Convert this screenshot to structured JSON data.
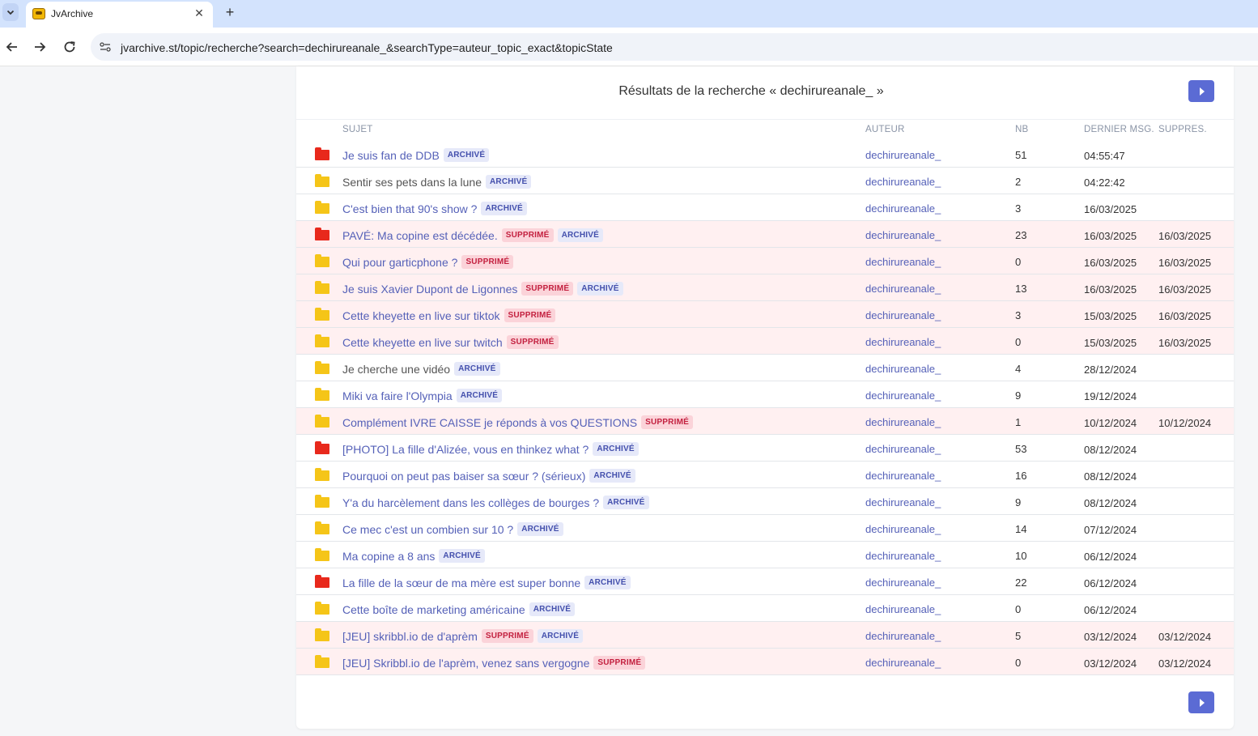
{
  "browser": {
    "tab_title": "JvArchive",
    "tab_close": "✕",
    "new_tab": "+",
    "url": "jvarchive.st/topic/recherche?search=dechirureanale_&searchType=auteur_topic_exact&topicState"
  },
  "page": {
    "title": "Résultats de la recherche « dechirureanale_ »",
    "columns": {
      "subject": "SUJET",
      "author": "AUTEUR",
      "nb": "NB",
      "last": "DERNIER MSG.",
      "deleted": "SUPPRES."
    },
    "badges": {
      "archived": "ARCHIVÉ",
      "deleted": "SUPPRIMÉ"
    },
    "accent_color": "#5b6bd4",
    "folder_colors": {
      "normal": "#f5c518",
      "hot": "#e8291c"
    }
  },
  "topics": [
    {
      "title": "Je suis fan de DDB",
      "author": "dechirureanale_",
      "nb": "51",
      "last": "04:55:47",
      "deleted_date": "",
      "folder": "red",
      "tags": [
        "archived"
      ],
      "deleted": false,
      "title_gray": false
    },
    {
      "title": "Sentir ses pets dans la lune",
      "author": "dechirureanale_",
      "nb": "2",
      "last": "04:22:42",
      "deleted_date": "",
      "folder": "yellow",
      "tags": [
        "archived"
      ],
      "deleted": false,
      "title_gray": true
    },
    {
      "title": "C'est bien that 90's show ?",
      "author": "dechirureanale_",
      "nb": "3",
      "last": "16/03/2025",
      "deleted_date": "",
      "folder": "yellow",
      "tags": [
        "archived"
      ],
      "deleted": false,
      "title_gray": false
    },
    {
      "title": "PAVÉ: Ma copine est décédée.",
      "author": "dechirureanale_",
      "nb": "23",
      "last": "16/03/2025",
      "deleted_date": "16/03/2025",
      "folder": "red",
      "tags": [
        "deleted",
        "archived"
      ],
      "deleted": true,
      "title_gray": false
    },
    {
      "title": "Qui pour garticphone ?",
      "author": "dechirureanale_",
      "nb": "0",
      "last": "16/03/2025",
      "deleted_date": "16/03/2025",
      "folder": "yellow",
      "tags": [
        "deleted"
      ],
      "deleted": true,
      "title_gray": false
    },
    {
      "title": "Je suis Xavier Dupont de Ligonnes",
      "author": "dechirureanale_",
      "nb": "13",
      "last": "16/03/2025",
      "deleted_date": "16/03/2025",
      "folder": "yellow",
      "tags": [
        "deleted",
        "archived"
      ],
      "deleted": true,
      "title_gray": false
    },
    {
      "title": "Cette kheyette en live sur tiktok",
      "author": "dechirureanale_",
      "nb": "3",
      "last": "15/03/2025",
      "deleted_date": "16/03/2025",
      "folder": "yellow",
      "tags": [
        "deleted"
      ],
      "deleted": true,
      "title_gray": false
    },
    {
      "title": "Cette kheyette en live sur twitch",
      "author": "dechirureanale_",
      "nb": "0",
      "last": "15/03/2025",
      "deleted_date": "16/03/2025",
      "folder": "yellow",
      "tags": [
        "deleted"
      ],
      "deleted": true,
      "title_gray": false
    },
    {
      "title": "Je cherche une vidéo",
      "author": "dechirureanale_",
      "nb": "4",
      "last": "28/12/2024",
      "deleted_date": "",
      "folder": "yellow",
      "tags": [
        "archived"
      ],
      "deleted": false,
      "title_gray": true
    },
    {
      "title": "Miki va faire l'Olympia",
      "author": "dechirureanale_",
      "nb": "9",
      "last": "19/12/2024",
      "deleted_date": "",
      "folder": "yellow",
      "tags": [
        "archived"
      ],
      "deleted": false,
      "title_gray": false
    },
    {
      "title": "Complément IVRE CAISSE je réponds à vos QUESTIONS",
      "author": "dechirureanale_",
      "nb": "1",
      "last": "10/12/2024",
      "deleted_date": "10/12/2024",
      "folder": "yellow",
      "tags": [
        "deleted"
      ],
      "deleted": true,
      "title_gray": false
    },
    {
      "title": "[PHOTO] La fille d'Alizée, vous en thinkez what ?",
      "author": "dechirureanale_",
      "nb": "53",
      "last": "08/12/2024",
      "deleted_date": "",
      "folder": "red",
      "tags": [
        "archived"
      ],
      "deleted": false,
      "title_gray": false
    },
    {
      "title": "Pourquoi on peut pas baiser sa sœur ? (sérieux)",
      "author": "dechirureanale_",
      "nb": "16",
      "last": "08/12/2024",
      "deleted_date": "",
      "folder": "yellow",
      "tags": [
        "archived"
      ],
      "deleted": false,
      "title_gray": false
    },
    {
      "title": "Y'a du harcèlement dans les collèges de bourges ?",
      "author": "dechirureanale_",
      "nb": "9",
      "last": "08/12/2024",
      "deleted_date": "",
      "folder": "yellow",
      "tags": [
        "archived"
      ],
      "deleted": false,
      "title_gray": false
    },
    {
      "title": "Ce mec c'est un combien sur 10 ?",
      "author": "dechirureanale_",
      "nb": "14",
      "last": "07/12/2024",
      "deleted_date": "",
      "folder": "yellow",
      "tags": [
        "archived"
      ],
      "deleted": false,
      "title_gray": false
    },
    {
      "title": "Ma copine a 8 ans",
      "author": "dechirureanale_",
      "nb": "10",
      "last": "06/12/2024",
      "deleted_date": "",
      "folder": "yellow",
      "tags": [
        "archived"
      ],
      "deleted": false,
      "title_gray": false
    },
    {
      "title": "La fille de la sœur de ma mère est super bonne",
      "author": "dechirureanale_",
      "nb": "22",
      "last": "06/12/2024",
      "deleted_date": "",
      "folder": "red",
      "tags": [
        "archived"
      ],
      "deleted": false,
      "title_gray": false
    },
    {
      "title": "Cette boîte de marketing américaine",
      "author": "dechirureanale_",
      "nb": "0",
      "last": "06/12/2024",
      "deleted_date": "",
      "folder": "yellow",
      "tags": [
        "archived"
      ],
      "deleted": false,
      "title_gray": false
    },
    {
      "title": "[JEU] skribbl.io de d'aprèm",
      "author": "dechirureanale_",
      "nb": "5",
      "last": "03/12/2024",
      "deleted_date": "03/12/2024",
      "folder": "yellow",
      "tags": [
        "deleted",
        "archived"
      ],
      "deleted": true,
      "title_gray": false
    },
    {
      "title": "[JEU] Skribbl.io de l'aprèm, venez sans vergogne",
      "author": "dechirureanale_",
      "nb": "0",
      "last": "03/12/2024",
      "deleted_date": "03/12/2024",
      "folder": "yellow",
      "tags": [
        "deleted"
      ],
      "deleted": true,
      "title_gray": false
    }
  ]
}
